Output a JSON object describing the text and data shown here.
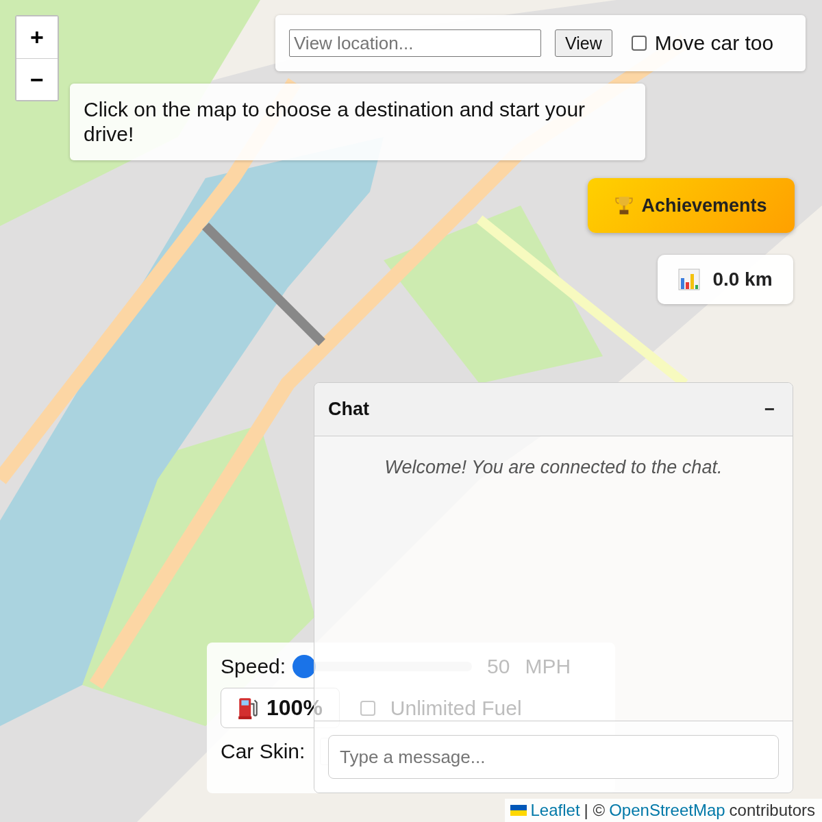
{
  "zoom_controls": {
    "zoom_in": "+",
    "zoom_out": "−"
  },
  "location_bar": {
    "placeholder": "View location...",
    "button": "View",
    "move_car": {
      "label": "Move car too",
      "checked": false
    }
  },
  "instruction": "Click on the map to choose a destination and start your drive!",
  "achievements_button": "Achievements",
  "distance": "0.0 km",
  "chat": {
    "title": "Chat",
    "minimize": "−",
    "messages": [
      {
        "kind": "system",
        "text": "Welcome! You are connected to the chat."
      }
    ],
    "input_placeholder": "Type a message..."
  },
  "drive_panel": {
    "speed_label": "Speed:",
    "speed": {
      "level": 0
    },
    "speed_value": "50",
    "speed_unit": "MPH",
    "fuel": "100%",
    "unlimited_fuel": {
      "label": "Unlimited Fuel",
      "checked": false
    },
    "car_skin_label": "Car Skin:"
  },
  "attribution": {
    "leaflet": "Leaflet",
    "separator": "| ©",
    "osm": "OpenStreetMap",
    "suffix": "contributors"
  }
}
